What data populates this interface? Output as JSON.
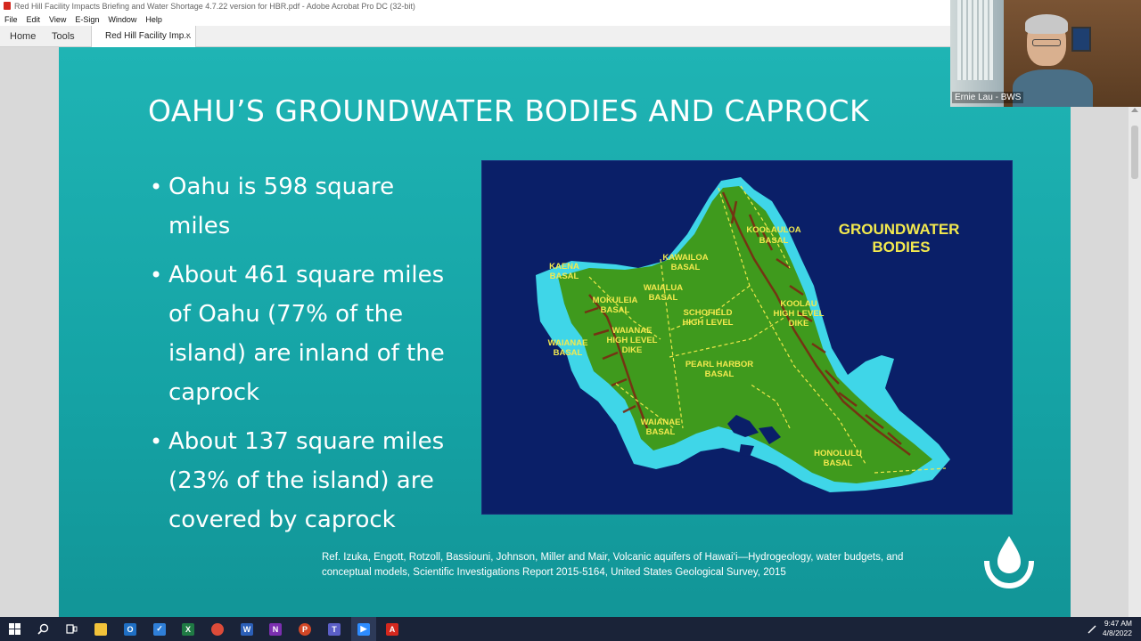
{
  "window": {
    "title": "Red Hill Facility Impacts Briefing and Water Shortage 4.7.22 version for HBR.pdf - Adobe Acrobat Pro DC (32-bit)"
  },
  "menu": [
    "File",
    "Edit",
    "View",
    "E-Sign",
    "Window",
    "Help"
  ],
  "tabs": {
    "home": "Home",
    "tools": "Tools",
    "document": "Red Hill Facility Imp...",
    "close": "×"
  },
  "slide": {
    "title": "OAHU’S GROUNDWATER BODIES AND CAPROCK",
    "bullets": [
      "Oahu is 598 square miles",
      "About 461 square miles of Oahu (77% of the island) are inland of the caprock",
      "About 137 square miles (23% of the island) are covered by caprock"
    ],
    "reference": "Ref. Izuka, Engott, Rotzoll, Bassiouni, Johnson, Miller and Mair, Volcanic aquifers of Hawai‘i—Hydrogeology, water budgets, and conceptual models, Scientific Investigations Report 2015-5164, United States Geological Survey, 2015"
  },
  "map": {
    "heading": [
      "GROUNDWATER",
      "BODIES"
    ],
    "labels": {
      "koolauloa": [
        "KOOLAULOA",
        "BASAL"
      ],
      "kawailoa": [
        "KAWAILOA",
        "BASAL"
      ],
      "kaena": [
        "KAENA",
        "BASAL"
      ],
      "waialua": [
        "WAIALUA",
        "BASAL"
      ],
      "mokuleia": [
        "MOKULEIA",
        "BASAL"
      ],
      "schofield": [
        "SCHOFIELD",
        "HIGH LEVEL"
      ],
      "koolau_dike": [
        "KOOLAU",
        "HIGH LEVEL",
        "DIKE"
      ],
      "waianae_dike": [
        "WAIANAE",
        "HIGH LEVEL",
        "DIKE"
      ],
      "waianae_basal_w": [
        "WAIANAE",
        "BASAL"
      ],
      "pearl_harbor": [
        "PEARL HARBOR",
        "BASAL"
      ],
      "waianae_basal_s": [
        "WAIANAE",
        "BASAL"
      ],
      "honolulu": [
        "HONOLULU",
        "BASAL"
      ]
    },
    "colors": {
      "ocean": "#0a1f68",
      "caprock": "#3fd6e8",
      "land": "#3f9a1d",
      "ridges": "#7a2a12",
      "boundaries": "#f0e84a",
      "label_text": "#f3e94e"
    }
  },
  "webcam": {
    "participant": "Ernie Lau - BWS"
  },
  "taskbar": {
    "time": "9:47 AM",
    "date": "4/8/2022",
    "apps": [
      "start-icon",
      "search-icon",
      "task-view-icon",
      "file-explorer-icon",
      "outlook-icon",
      "todo-icon",
      "excel-icon",
      "chrome-icon",
      "word-icon",
      "onenote-icon",
      "powerpoint-icon",
      "teams-icon",
      "zoom-icon",
      "acrobat-icon"
    ]
  }
}
